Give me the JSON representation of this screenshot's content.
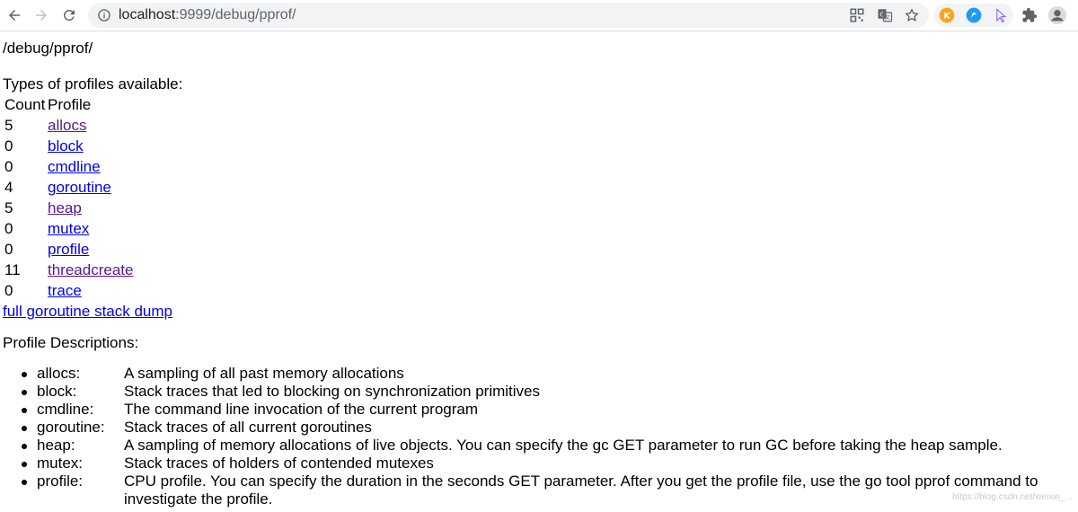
{
  "browser": {
    "url_host": "localhost",
    "url_path": ":9999/debug/pprof/"
  },
  "page": {
    "path_heading": "/debug/pprof/",
    "types_heading": "Types of profiles available:",
    "table_headers": [
      "Count",
      "Profile"
    ],
    "profiles": [
      {
        "count": "5",
        "name": "allocs",
        "visited": true
      },
      {
        "count": "0",
        "name": "block",
        "visited": false
      },
      {
        "count": "0",
        "name": "cmdline",
        "visited": false
      },
      {
        "count": "4",
        "name": "goroutine",
        "visited": false
      },
      {
        "count": "5",
        "name": "heap",
        "visited": true
      },
      {
        "count": "0",
        "name": "mutex",
        "visited": false
      },
      {
        "count": "0",
        "name": "profile",
        "visited": false
      },
      {
        "count": "11",
        "name": "threadcreate",
        "visited": true
      },
      {
        "count": "0",
        "name": "trace",
        "visited": false
      }
    ],
    "full_dump_link": "full goroutine stack dump",
    "desc_heading": "Profile Descriptions:",
    "descriptions": [
      {
        "term": "allocs:",
        "text": "A sampling of all past memory allocations"
      },
      {
        "term": "block:",
        "text": "Stack traces that led to blocking on synchronization primitives"
      },
      {
        "term": "cmdline:",
        "text": "The command line invocation of the current program"
      },
      {
        "term": "goroutine:",
        "text": "Stack traces of all current goroutines"
      },
      {
        "term": "heap:",
        "text": "A sampling of memory allocations of live objects. You can specify the gc GET parameter to run GC before taking the heap sample."
      },
      {
        "term": "mutex:",
        "text": "Stack traces of holders of contended mutexes"
      },
      {
        "term": "profile:",
        "text": "CPU profile. You can specify the duration in the seconds GET parameter. After you get the profile file, use the go tool pprof command to investigate the profile."
      }
    ],
    "watermark": "https://blog.csdn.net/weixin_..."
  },
  "colors": {
    "link": "#0000ee",
    "visited_link": "#551a8b"
  }
}
